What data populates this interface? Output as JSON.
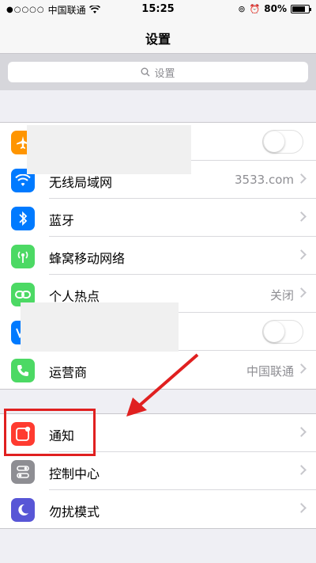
{
  "status_bar": {
    "signal_dots": "●○○○○",
    "carrier": "中国联通",
    "time": "15:25",
    "battery": "80%",
    "battery_level": 0.8
  },
  "nav": {
    "title": "设置"
  },
  "search": {
    "placeholder": "设置"
  },
  "group1": {
    "rows": [
      {
        "label": "",
        "value": "",
        "icon": "airplane-icon",
        "color": "#ff9500",
        "control": "toggle"
      },
      {
        "label": "无线局域网",
        "value": "3533.com",
        "icon": "wifi-icon",
        "color": "#007aff",
        "control": "chevron"
      },
      {
        "label": "蓝牙",
        "value": "",
        "icon": "bluetooth-icon",
        "color": "#007aff",
        "control": "chevron"
      },
      {
        "label": "蜂窝移动网络",
        "value": "",
        "icon": "cellular-icon",
        "color": "#4cd964",
        "control": "chevron"
      },
      {
        "label": "个人热点",
        "value": "关闭",
        "icon": "hotspot-icon",
        "color": "#4cd964",
        "control": "chevron"
      },
      {
        "label": "",
        "value": "",
        "icon": "vpn-icon",
        "color": "#007aff",
        "control": "toggle"
      },
      {
        "label": "运营商",
        "value": "中国联通",
        "icon": "phone-icon",
        "color": "#4cd964",
        "control": "chevron"
      }
    ]
  },
  "group2": {
    "rows": [
      {
        "label": "通知",
        "icon": "notification-icon",
        "color": "#ff3b30"
      },
      {
        "label": "控制中心",
        "icon": "control-center-icon",
        "color": "#8e8e93"
      },
      {
        "label": "勿扰模式",
        "icon": "moon-icon",
        "color": "#5856d6"
      }
    ]
  },
  "colors": {
    "highlight": "#e02020"
  }
}
